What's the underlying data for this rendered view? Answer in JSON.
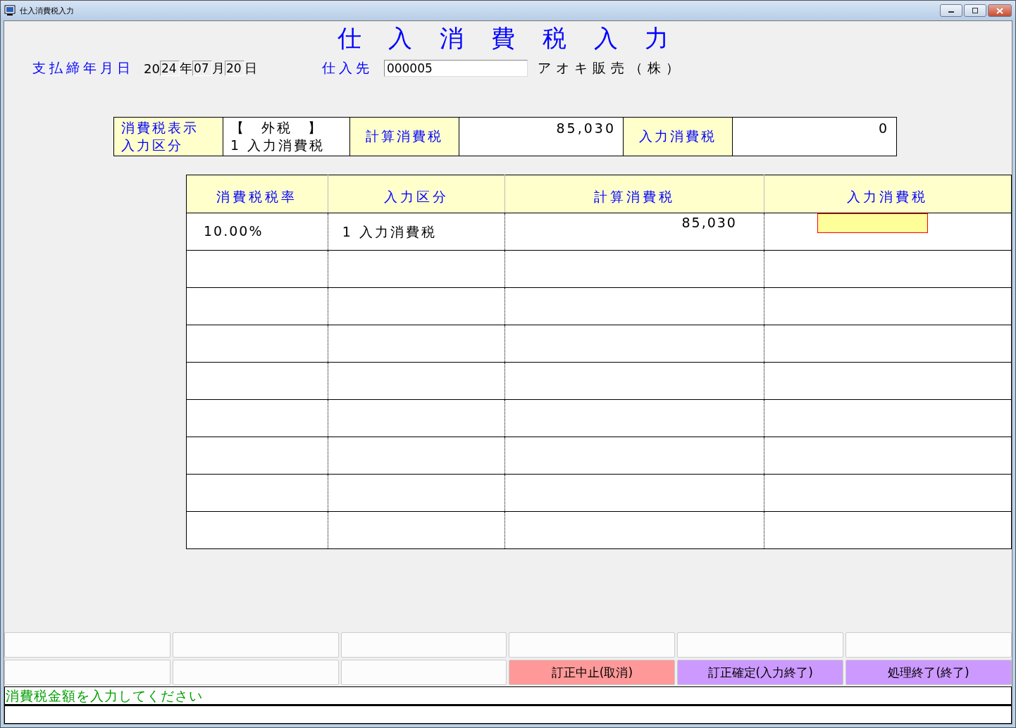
{
  "window": {
    "title": "仕入消費税入力"
  },
  "heading": "仕 入 消 費 税 入 力",
  "date": {
    "label": "支払締年月日",
    "century": "20",
    "year": "24",
    "year_unit": "年",
    "month": "07",
    "month_unit": "月",
    "day": "20",
    "day_unit": "日"
  },
  "supplier": {
    "label": "仕入先",
    "code": "000005",
    "name": "アオキ販売（株）"
  },
  "summary": {
    "mode_label_1": "消費税表示",
    "mode_label_2": "入力区分",
    "mode_value_1": "【　外税　】",
    "mode_value_2": "1 入力消費税",
    "calc_label": "計算消費税",
    "calc_value": "85,030",
    "input_label": "入力消費税",
    "input_value": "0"
  },
  "table": {
    "columns": [
      "消費税税率",
      "入力区分",
      "計算消費税",
      "入力消費税"
    ],
    "rows": [
      {
        "rate": "10.00%",
        "category": "1 入力消費税",
        "calc_tax": "85,030",
        "editing": true
      }
    ]
  },
  "function_keys": [
    {
      "kind": "blank"
    },
    {
      "kind": "blank"
    },
    {
      "kind": "blank"
    },
    {
      "kind": "blank"
    },
    {
      "kind": "blank"
    },
    {
      "kind": "blank"
    },
    {
      "kind": "blank"
    },
    {
      "kind": "blank"
    },
    {
      "kind": "blank"
    },
    {
      "kind": "action",
      "label": "訂正中止(取消)",
      "color": "#ff9999"
    },
    {
      "kind": "action",
      "label": "訂正確定(入力終了)",
      "color": "#cc99ff"
    },
    {
      "kind": "action",
      "label": "処理終了(終了)",
      "color": "#cc99ff"
    }
  ],
  "status_bar": {
    "message": "消費税金額を入力してください"
  }
}
